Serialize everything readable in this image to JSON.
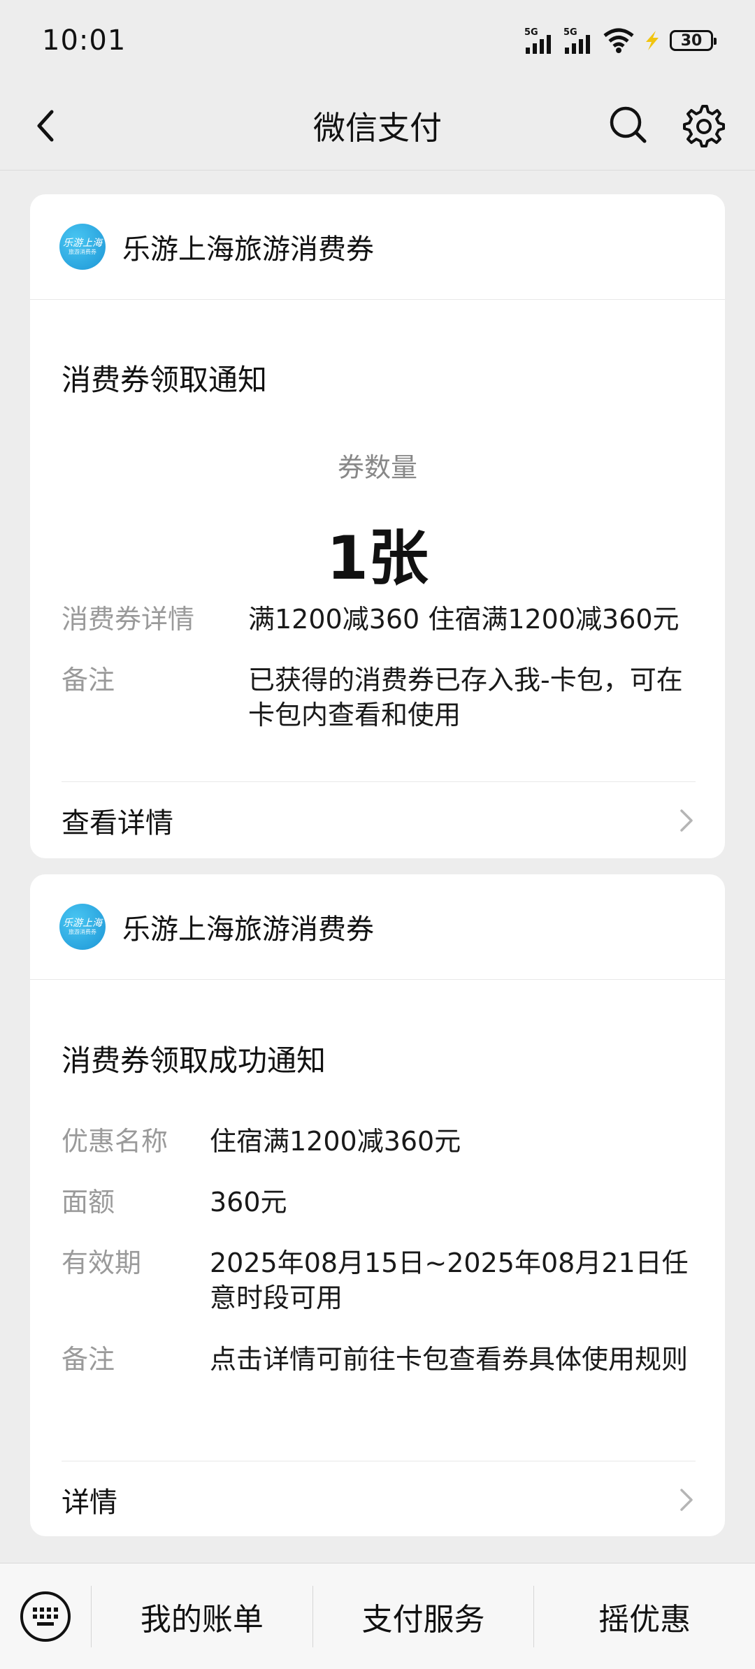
{
  "status_bar": {
    "time": "10:01",
    "network_1": "5G",
    "network_2": "5G",
    "battery": "30"
  },
  "nav": {
    "title": "微信支付"
  },
  "cards": [
    {
      "brand_name": "乐游上海旅游消费券",
      "logo_text_1": "乐游上海",
      "logo_text_2": "旅游消费券",
      "notice_title": "消费券领取通知",
      "quantity_label": "券数量",
      "quantity_value": "1张",
      "rows": [
        {
          "key": "消费券详情",
          "value": "满1200减360 住宿满1200减360元"
        },
        {
          "key": "备注",
          "value": "已获得的消费券已存入我-卡包，可在卡包内查看和使用"
        }
      ],
      "footer_label": "查看详情"
    },
    {
      "brand_name": "乐游上海旅游消费券",
      "logo_text_1": "乐游上海",
      "logo_text_2": "旅游消费券",
      "notice_title": "消费券领取成功通知",
      "rows": [
        {
          "key": "优惠名称",
          "value": "住宿满1200减360元"
        },
        {
          "key": "面额",
          "value": "360元"
        },
        {
          "key": "有效期",
          "value": "2025年08月15日~2025年08月21日任意时段可用"
        },
        {
          "key": "备注",
          "value": "点击详情可前往卡包查看券具体使用规则"
        }
      ],
      "footer_label": "详情"
    }
  ],
  "bottom_bar": {
    "items": [
      "我的账单",
      "支付服务",
      "摇优惠"
    ]
  }
}
